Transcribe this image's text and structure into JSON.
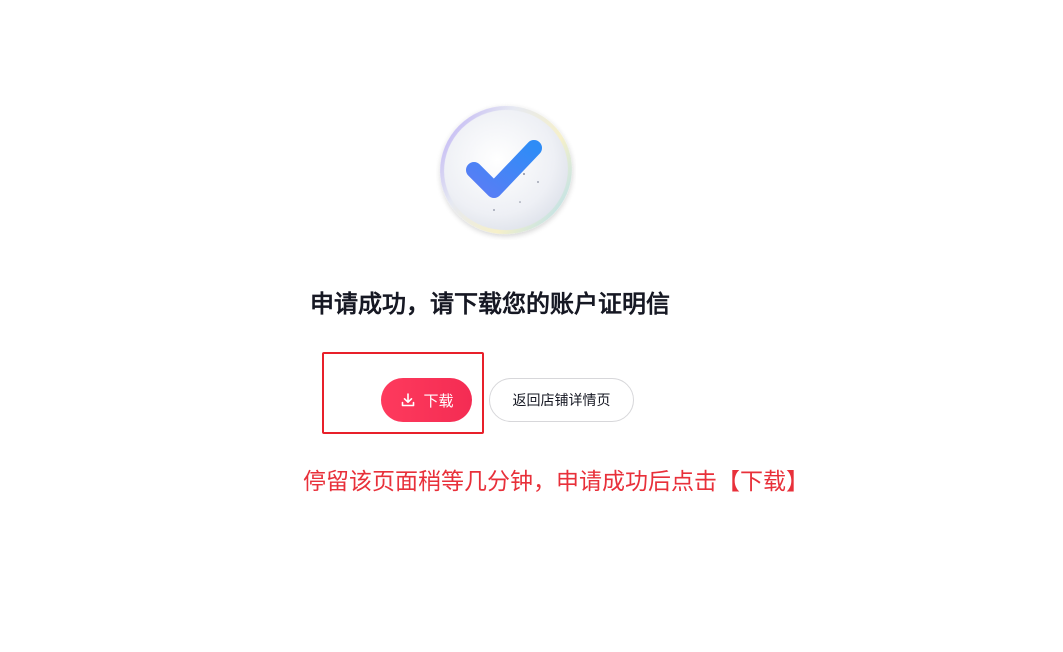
{
  "status_icon": "success-check-icon",
  "title": "申请成功，请下载您的账户证明信",
  "buttons": {
    "download": {
      "label": "下载",
      "icon": "download-icon"
    },
    "back": {
      "label": "返回店铺详情页"
    }
  },
  "instruction_note": "停留该页面稍等几分钟，申请成功后点击【下载】",
  "colors": {
    "primary": "#fe2c55",
    "annotation_red": "#e8303a",
    "check_blue": "#2f6ff6"
  }
}
